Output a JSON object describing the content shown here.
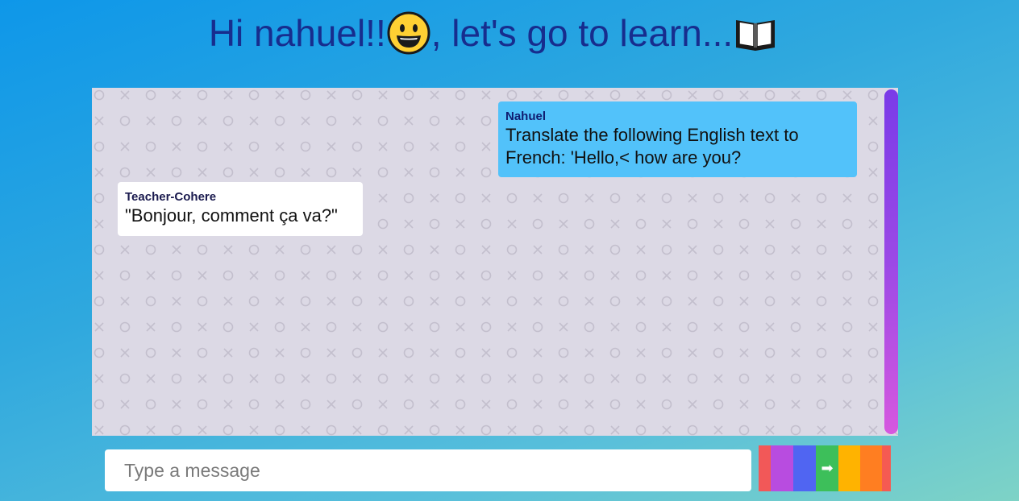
{
  "header": {
    "greeting_prefix": "Hi nahuel!!",
    "greeting_suffix": ", let's go to learn...",
    "icons": [
      "grinning-face-emoji",
      "open-book-emoji"
    ]
  },
  "chat": {
    "messages": [
      {
        "sender": "Nahuel",
        "text": "Translate the following English text to French: 'Hello,< how are you?",
        "role": "user",
        "background": "#52c2fa"
      },
      {
        "sender": "Teacher-Cohere",
        "text": "\"Bonjour, comment ça va?\"",
        "role": "assistant",
        "background": "#ffffff"
      }
    ],
    "background": "#dcd9e5",
    "scrollbar_color": "#8a45e6"
  },
  "composer": {
    "placeholder": "Type a message",
    "value": "",
    "send_icon": "right-arrow-icon",
    "send_glyph": "➡"
  },
  "colors": {
    "title": "#172d8e",
    "page_gradient_start": "#0e97e9",
    "page_gradient_end": "#7ed3c6"
  }
}
